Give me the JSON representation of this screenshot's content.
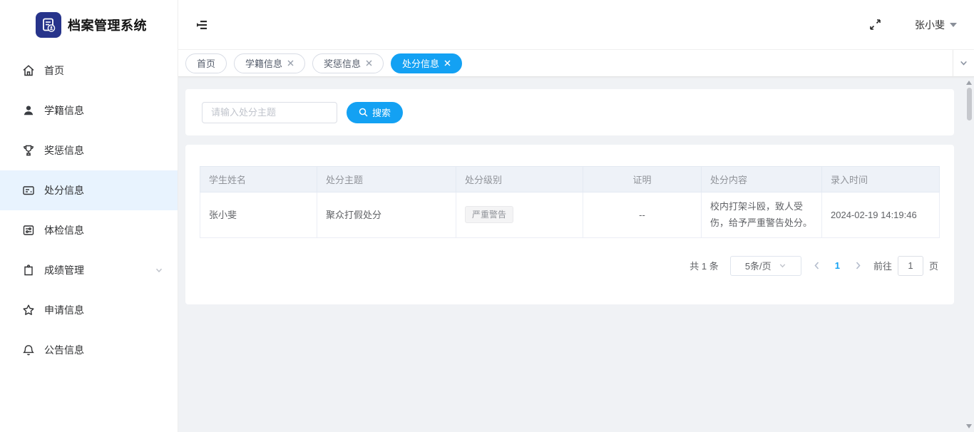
{
  "app": {
    "title": "档案管理系统",
    "user_name": "张小斐"
  },
  "colors": {
    "primary": "#13a1f3",
    "logo_background": "#27348b",
    "content_background": "#f0f2f5",
    "sidebar_active_background": "#e8f3fe"
  },
  "sidebar": {
    "items": [
      {
        "label": "首页",
        "icon": "home-icon",
        "active": false
      },
      {
        "label": "学籍信息",
        "icon": "user-icon",
        "active": false
      },
      {
        "label": "奖惩信息",
        "icon": "trophy-icon",
        "active": false
      },
      {
        "label": "处分信息",
        "icon": "form-icon",
        "active": true
      },
      {
        "label": "体检信息",
        "icon": "health-card-icon",
        "active": false
      },
      {
        "label": "成绩管理",
        "icon": "clipboard-icon",
        "active": false,
        "has_submenu": true
      },
      {
        "label": "申请信息",
        "icon": "star-icon",
        "active": false
      },
      {
        "label": "公告信息",
        "icon": "bell-icon",
        "active": false
      }
    ]
  },
  "tabs": [
    {
      "label": "首页",
      "closable": false,
      "active": false
    },
    {
      "label": "学籍信息",
      "closable": true,
      "active": false
    },
    {
      "label": "奖惩信息",
      "closable": true,
      "active": false
    },
    {
      "label": "处分信息",
      "closable": true,
      "active": true
    }
  ],
  "search": {
    "placeholder": "请输入处分主题",
    "button_label": "搜索"
  },
  "table": {
    "headers": [
      "学生姓名",
      "处分主题",
      "处分级别",
      "证明",
      "处分内容",
      "录入时间"
    ],
    "rows": [
      {
        "student": "张小斐",
        "subject": "聚众打假处分",
        "level": "严重警告",
        "proof": "--",
        "content": "校内打架斗殴，致人受伤，给予严重警告处分。",
        "time": "2024-02-19 14:19:46"
      }
    ]
  },
  "pagination": {
    "total": "共 1 条",
    "page_size": "5条/页",
    "current_page": "1",
    "goto_label": "前往",
    "goto_value": "1",
    "page_unit": "页"
  },
  "icons": {
    "fold-icon": "sidebar collapse toggle",
    "fullscreen-icon": "toggle fullscreen",
    "search-icon": "magnifier",
    "close-icon": "x",
    "chevron-down-icon": "v",
    "caret-down-icon": "filled triangle"
  }
}
